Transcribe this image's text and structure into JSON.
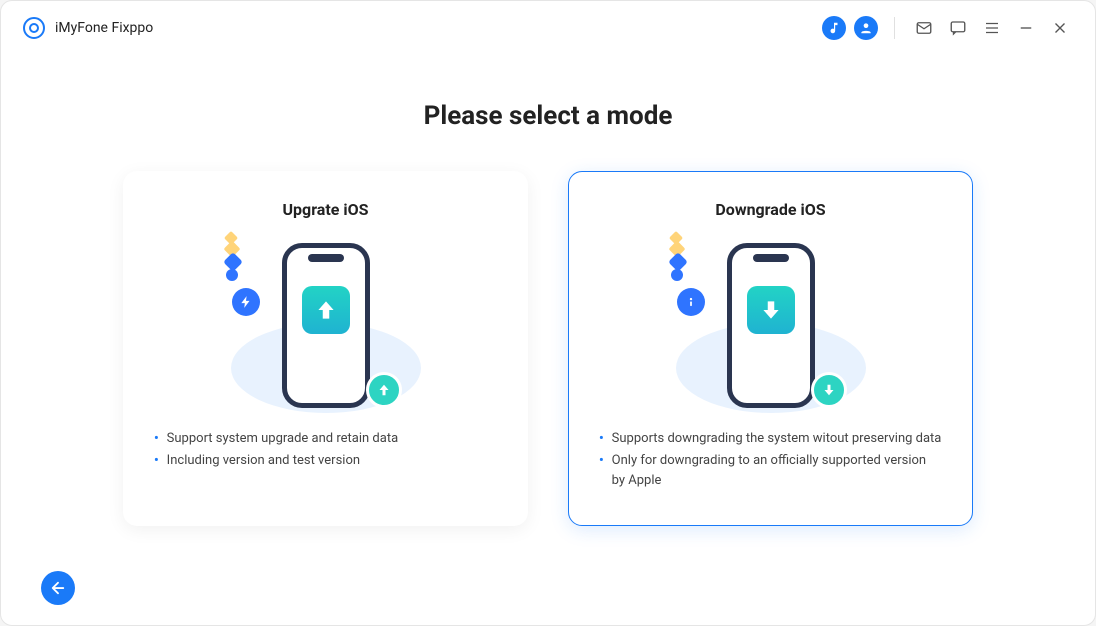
{
  "app": {
    "title": "iMyFone Fixppo"
  },
  "page": {
    "heading": "Please select a mode"
  },
  "cards": {
    "upgrade": {
      "title": "Upgrate iOS",
      "bullet1": "Support system upgrade and retain data",
      "bullet2": "Including version and test version",
      "selected": false,
      "arrowDirection": "up"
    },
    "downgrade": {
      "title": "Downgrade iOS",
      "bullet1": "Supports downgrading the system witout preserving data",
      "bullet2": "Only for downgrading to an officially supported version by Apple",
      "selected": true,
      "arrowDirection": "down"
    }
  },
  "titlebarIcons": {
    "music": "music-icon",
    "user": "user-icon",
    "mail": "mail-icon",
    "chat": "chat-icon",
    "menu": "menu-icon",
    "minimize": "minimize-icon",
    "close": "close-icon"
  },
  "colors": {
    "primary": "#1a7af8",
    "teal": "#2dd4c2",
    "phone": "#2a3550"
  }
}
